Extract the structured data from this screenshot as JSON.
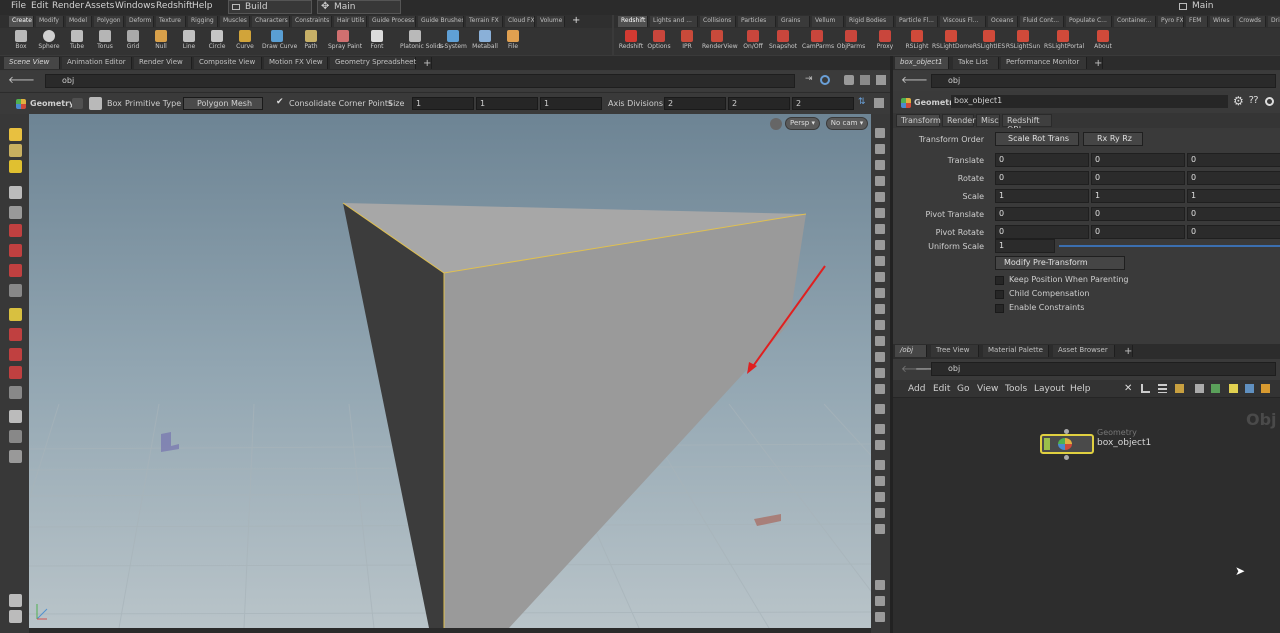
{
  "menubar": {
    "items": [
      "File",
      "Edit",
      "Render",
      "Assets",
      "Windows",
      "Redshift",
      "Help"
    ],
    "desktop1": "Build",
    "desktop2": "Main",
    "desktop3": "Main"
  },
  "shelf_left": {
    "tabs": [
      "Create",
      "Modify",
      "Model",
      "Polygon",
      "Deform",
      "Texture",
      "Rigging",
      "Muscles",
      "Characters",
      "Constraints",
      "Hair Utils",
      "Guide Process",
      "Guide Brushes",
      "Terrain FX",
      "Cloud FX",
      "Volume"
    ],
    "tools": [
      {
        "label": "Box",
        "icon": "box-icon",
        "color": "#b9b9b9"
      },
      {
        "label": "Sphere",
        "icon": "sphere-icon",
        "color": "#d0d0d0"
      },
      {
        "label": "Tube",
        "icon": "tube-icon",
        "color": "#bdbdbd"
      },
      {
        "label": "Torus",
        "icon": "torus-icon",
        "color": "#b5b5b5"
      },
      {
        "label": "Grid",
        "icon": "grid-icon",
        "color": "#a9a9a9"
      },
      {
        "label": "Null",
        "icon": "null-icon",
        "color": "#d8a04a"
      },
      {
        "label": "Line",
        "icon": "line-icon",
        "color": "#c0c0c0"
      },
      {
        "label": "Circle",
        "icon": "circle-icon",
        "color": "#c5c5c5"
      },
      {
        "label": "Curve",
        "icon": "curve-icon",
        "color": "#d1a43a"
      },
      {
        "label": "Draw Curve",
        "icon": "draw-curve-icon",
        "color": "#5a9fd4"
      },
      {
        "label": "Path",
        "icon": "path-icon",
        "color": "#c7b067"
      },
      {
        "label": "Spray Paint",
        "icon": "spray-paint-icon",
        "color": "#d07070"
      },
      {
        "label": "Font",
        "icon": "font-icon",
        "color": "#dcdcdc"
      },
      {
        "label": "Platonic Solids",
        "icon": "platonic-solids-icon",
        "color": "#b9b9b9"
      },
      {
        "label": "L-System",
        "icon": "l-system-icon",
        "color": "#5fa0d6"
      },
      {
        "label": "Metaball",
        "icon": "metaball-icon",
        "color": "#8ab0d8"
      },
      {
        "label": "File",
        "icon": "file-icon",
        "color": "#e0a050"
      }
    ]
  },
  "shelf_right": {
    "tabs": [
      "Redshift",
      "Lights and ...",
      "Collisions",
      "Particles",
      "Grains",
      "Vellum",
      "Rigid Bodies",
      "Particle Fl...",
      "Viscous Fl...",
      "Oceans",
      "Fluid Cont...",
      "Populate C...",
      "Container...",
      "Pyro FX",
      "FEM",
      "Wires",
      "Crowds",
      "Drive Sim..."
    ],
    "tools": [
      {
        "label": "Redshift",
        "icon": "redshift-icon",
        "color": "#d23a32"
      },
      {
        "label": "Options",
        "icon": "options-icon",
        "color": "#c9463c"
      },
      {
        "label": "IPR",
        "icon": "ipr-icon",
        "color": "#c94a3a"
      },
      {
        "label": "RenderView",
        "icon": "renderview-icon",
        "color": "#c84a3b"
      },
      {
        "label": "On/Off",
        "icon": "on-off-icon",
        "color": "#c9463c"
      },
      {
        "label": "Snapshot",
        "icon": "snapshot-icon",
        "color": "#c9463c"
      },
      {
        "label": "CamParms",
        "icon": "camparms-icon",
        "color": "#c9463c"
      },
      {
        "label": "ObjParms",
        "icon": "objparms-icon",
        "color": "#c9463c"
      },
      {
        "label": "Proxy",
        "icon": "proxy-icon",
        "color": "#c9463c"
      },
      {
        "label": "RSLight",
        "icon": "rslight-icon",
        "color": "#d04a3a"
      },
      {
        "label": "RSLightDome",
        "icon": "rslightdome-icon",
        "color": "#d04a3a"
      },
      {
        "label": "RSLightIES",
        "icon": "rslighties-icon",
        "color": "#d04a3a"
      },
      {
        "label": "RSLightSun",
        "icon": "rslightsun-icon",
        "color": "#d04a3a"
      },
      {
        "label": "RSLightPortal",
        "icon": "rslightportal-icon",
        "color": "#d04a3a"
      },
      {
        "label": "About",
        "icon": "about-icon",
        "color": "#d04a3a"
      }
    ]
  },
  "viewport_tabs": [
    "Scene View",
    "Animation Editor",
    "Render View",
    "Composite View",
    "Motion FX View",
    "Geometry Spreadsheet",
    "+"
  ],
  "viewport_path": "obj",
  "options": {
    "geometry": "Geometry",
    "box": "Box",
    "primitive_type_label": "Primitive Type",
    "primitive_type_value": "Polygon Mesh",
    "consolidate": "Consolidate Corner Points",
    "size_label": "Size",
    "size": [
      "1",
      "1",
      "1"
    ],
    "axis_div_label": "Axis Divisions",
    "axis_div": [
      "2",
      "2",
      "2"
    ]
  },
  "viewport": {
    "persp": "Persp",
    "nocam": "No cam"
  },
  "right_tabs": [
    "box_object1",
    "Take List",
    "Performance Monitor",
    "+"
  ],
  "param_path": "obj",
  "param_header": {
    "type": "Geometry",
    "name": "box_object1"
  },
  "param_tabs": [
    "Transform",
    "Render",
    "Misc",
    "Redshift OBJ"
  ],
  "params": {
    "transform_order_label": "Transform Order",
    "transform_order": "Scale Rot Trans",
    "rot_order": "Rx Ry Rz",
    "rows": [
      {
        "label": "Translate",
        "values": [
          "0",
          "0",
          "0"
        ]
      },
      {
        "label": "Rotate",
        "values": [
          "0",
          "0",
          "0"
        ]
      },
      {
        "label": "Scale",
        "values": [
          "1",
          "1",
          "1"
        ]
      },
      {
        "label": "Pivot Translate",
        "values": [
          "0",
          "0",
          "0"
        ]
      },
      {
        "label": "Pivot Rotate",
        "values": [
          "0",
          "0",
          "0"
        ]
      }
    ],
    "uniform_scale_label": "Uniform Scale",
    "uniform_scale": "1",
    "modify_pre": "Modify Pre-Transform",
    "checks": [
      "Keep Position When Parenting",
      "Child Compensation",
      "Enable Constraints"
    ]
  },
  "net_tabs": [
    "/obj",
    "Tree View",
    "Material Palette",
    "Asset Browser",
    "+"
  ],
  "net_path": "obj",
  "net_menu": [
    "Add",
    "Edit",
    "Go",
    "View",
    "Tools",
    "Layout",
    "Help"
  ],
  "network": {
    "watermark": "Obj",
    "node_type": "Geometry",
    "node_name": "box_object1"
  }
}
